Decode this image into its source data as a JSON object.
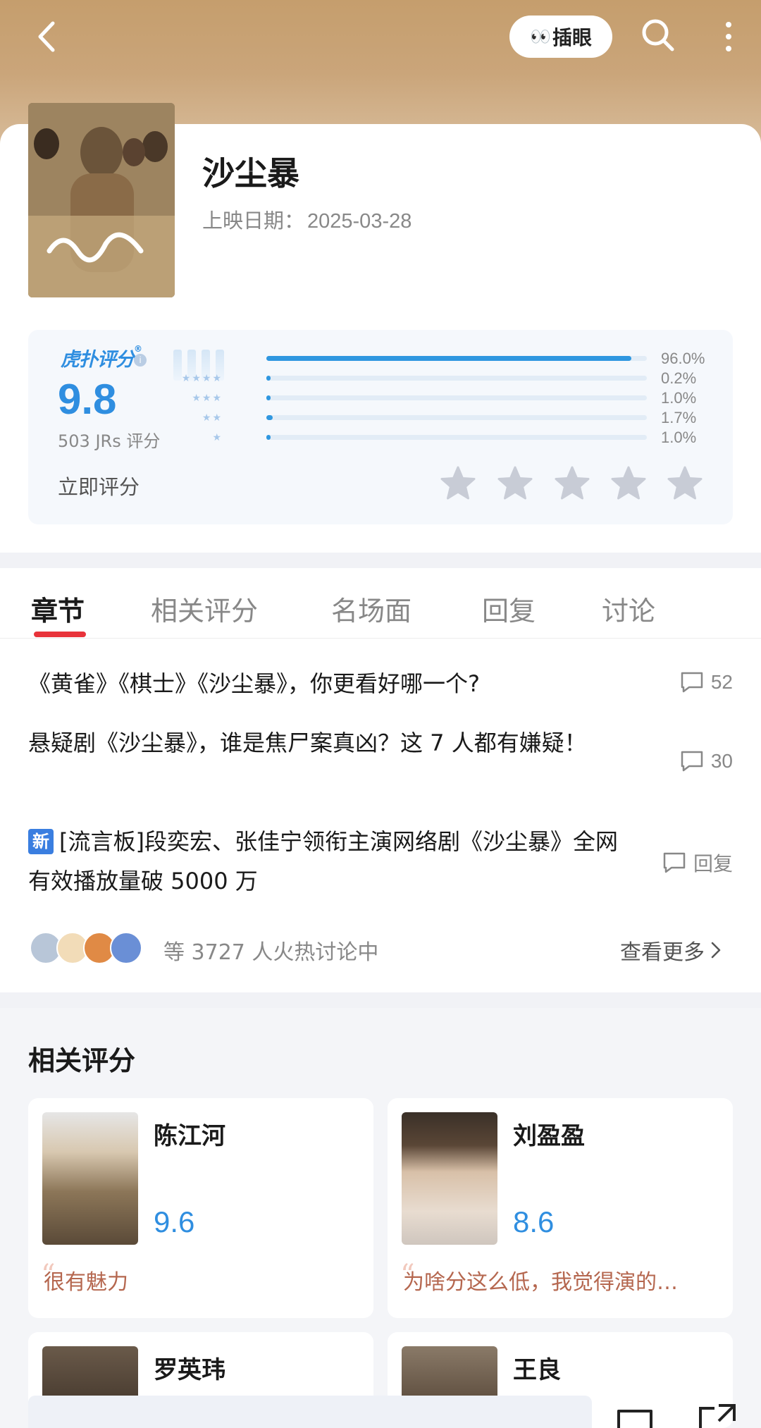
{
  "header": {
    "pill_emoji": "👀",
    "pill_label": "插眼"
  },
  "movie": {
    "title": "沙尘暴",
    "release_label": "上映日期：",
    "release_date": "2025-03-28"
  },
  "rating": {
    "brand": "虎扑评分",
    "brand_reg": "®",
    "score": "9.8",
    "votes": "503 JRs 评分",
    "rate_now": "立即评分",
    "distribution": [
      {
        "stars": 5,
        "percent": 96.0,
        "label": "96.0%"
      },
      {
        "stars": 4,
        "percent": 0.2,
        "label": "0.2%"
      },
      {
        "stars": 3,
        "percent": 1.0,
        "label": "1.0%"
      },
      {
        "stars": 2,
        "percent": 1.7,
        "label": "1.7%"
      },
      {
        "stars": 1,
        "percent": 1.0,
        "label": "1.0%"
      }
    ]
  },
  "tabs": [
    {
      "label": "章节",
      "active": true
    },
    {
      "label": "相关评分",
      "active": false
    },
    {
      "label": "名场面",
      "active": false
    },
    {
      "label": "回复",
      "active": false
    },
    {
      "label": "讨论",
      "active": false
    }
  ],
  "threads": [
    {
      "title": "《黄雀》《棋士》《沙尘暴》，你更看好哪一个?",
      "meta": "52"
    },
    {
      "title": "悬疑剧《沙尘暴》，谁是焦尸案真凶？这 7 人都有嫌疑！",
      "meta": "30"
    },
    {
      "badge": "新",
      "title": "[流言板]段奕宏、张佳宁领衔主演网络剧《沙尘暴》全网有效播放量破 5000 万",
      "meta": "回复"
    }
  ],
  "discussion": {
    "count_text": "等 3727 人火热讨论中",
    "more": "查看更多"
  },
  "related": {
    "title": "相关评分",
    "cards": [
      {
        "name": "陈江河",
        "score": "9.6",
        "quote": "很有魅力"
      },
      {
        "name": "刘盈盈",
        "score": "8.6",
        "quote": "为啥分这么低，我觉得演的…"
      },
      {
        "name": "罗英玮"
      },
      {
        "name": "王良"
      }
    ]
  },
  "colors": {
    "accent": "#2f8ee0",
    "tab_active": "#e8333a",
    "quote": "#b5674f"
  }
}
